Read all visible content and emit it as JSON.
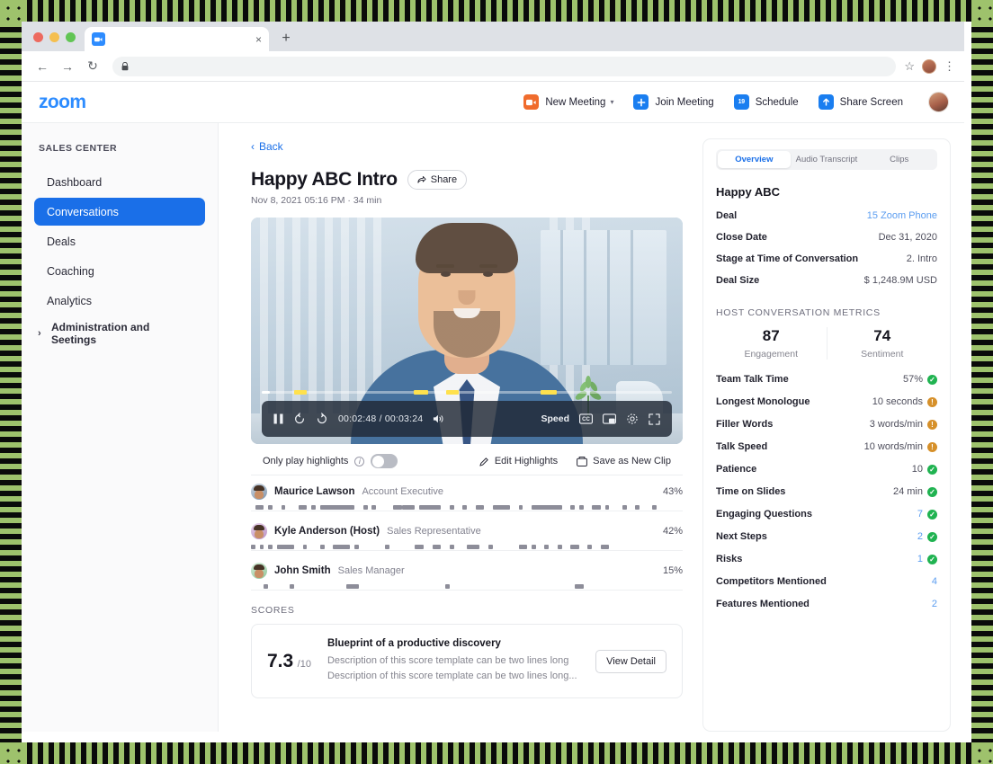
{
  "browser": {
    "tab_title": "",
    "tab_close_glyph": "×",
    "new_tab_glyph": "+",
    "back_glyph": "←",
    "forward_glyph": "→",
    "reload_glyph": "↻",
    "lock_glyph": "🔒",
    "url": "",
    "star_glyph": "☆",
    "menu_glyph": "⋮"
  },
  "app": {
    "logo": "zoom",
    "nav": [
      {
        "label": "New Meeting",
        "icon": "video-camera-icon",
        "has_caret": true,
        "caret": "▾"
      },
      {
        "label": "Join Meeting",
        "icon": "plus-icon",
        "has_caret": false,
        "caret": ""
      },
      {
        "label": "Schedule",
        "icon": "calendar-icon",
        "has_caret": false,
        "caret": ""
      },
      {
        "label": "Share Screen",
        "icon": "upload-arrow-icon",
        "has_caret": false,
        "caret": ""
      }
    ],
    "calendar_day": "19"
  },
  "sidebar": {
    "heading": "SALES CENTER",
    "items": [
      {
        "label": "Dashboard",
        "active": false
      },
      {
        "label": "Conversations",
        "active": true
      },
      {
        "label": "Deals",
        "active": false
      },
      {
        "label": "Coaching",
        "active": false
      },
      {
        "label": "Analytics",
        "active": false
      }
    ],
    "admin": {
      "label": "Administration and Seetings",
      "chevron": "›"
    }
  },
  "content": {
    "back_label": "Back",
    "back_chevron": "‹",
    "title": "Happy ABC Intro",
    "share_label": "Share",
    "subtitle": "Nov 8, 2021 05:16 PM · 34 min",
    "player": {
      "pause_glyph": "▐▐",
      "rewind_label": "10",
      "forward_label": "10",
      "time": "00:02:48 / 00:03:24",
      "speed_label": "Speed",
      "cc_label": "CC",
      "progress_percent": 2,
      "highlight_markers": [
        8,
        37,
        45,
        68
      ]
    },
    "highlights_bar": {
      "toggle_label": "Only play highlights",
      "toggle_on": false,
      "edit_label": "Edit Highlights",
      "save_clip_label": "Save as New Clip"
    },
    "speakers": [
      {
        "name": "Maurice Lawson",
        "role": "Account Executive",
        "percent": "43%",
        "segments": [
          [
            1,
            2
          ],
          [
            4,
            1
          ],
          [
            7,
            1
          ],
          [
            11,
            2
          ],
          [
            14,
            1
          ],
          [
            16,
            8
          ],
          [
            26,
            1
          ],
          [
            28,
            1
          ],
          [
            33,
            2
          ],
          [
            35,
            3
          ],
          [
            39,
            5
          ],
          [
            46,
            1
          ],
          [
            49,
            1
          ],
          [
            52,
            2
          ],
          [
            56,
            4
          ],
          [
            62,
            1
          ],
          [
            65,
            7
          ],
          [
            74,
            1
          ],
          [
            76,
            1
          ],
          [
            79,
            2
          ],
          [
            82,
            1
          ],
          [
            86,
            1
          ],
          [
            89,
            1
          ],
          [
            93,
            1
          ]
        ]
      },
      {
        "name": "Kyle Anderson (Host)",
        "role": "Sales Representative",
        "percent": "42%",
        "segments": [
          [
            0,
            1
          ],
          [
            2,
            1
          ],
          [
            4,
            1
          ],
          [
            6,
            4
          ],
          [
            12,
            1
          ],
          [
            16,
            1
          ],
          [
            19,
            4
          ],
          [
            24,
            1
          ],
          [
            31,
            1
          ],
          [
            38,
            2
          ],
          [
            42,
            2
          ],
          [
            46,
            1
          ],
          [
            50,
            3
          ],
          [
            55,
            1
          ],
          [
            62,
            2
          ],
          [
            65,
            1
          ],
          [
            68,
            1
          ],
          [
            71,
            1
          ],
          [
            74,
            2
          ],
          [
            78,
            1
          ],
          [
            81,
            2
          ]
        ]
      },
      {
        "name": "John Smith",
        "role": "Sales Manager",
        "percent": "15%",
        "segments": [
          [
            3,
            1
          ],
          [
            9,
            1
          ],
          [
            22,
            3
          ],
          [
            45,
            1
          ],
          [
            75,
            2
          ]
        ]
      }
    ],
    "scores_heading": "SCORES",
    "score": {
      "value": "7.3",
      "denominator": "/10",
      "title": "Blueprint of a productive discovery",
      "desc_line1": "Description of this score template can be two lines long",
      "desc_line2": "Description of this score template can be two lines long...",
      "detail_label": "View Detail"
    }
  },
  "panel": {
    "tabs": [
      {
        "label": "Overview",
        "active": true
      },
      {
        "label": "Audio Transcript",
        "active": false
      },
      {
        "label": "Clips",
        "active": false
      }
    ],
    "title": "Happy ABC",
    "fields": [
      {
        "key": "Deal",
        "value": "15 Zoom Phone",
        "link": true
      },
      {
        "key": "Close Date",
        "value": "Dec 31, 2020",
        "link": false
      },
      {
        "key": "Stage at Time of Conversation",
        "value": "2. Intro",
        "link": false
      },
      {
        "key": "Deal Size",
        "value": "$ 1,248.9M USD",
        "link": false
      }
    ],
    "metrics_heading": "HOST CONVERSATION METRICS",
    "bignums": [
      {
        "value": "87",
        "label": "Engagement"
      },
      {
        "value": "74",
        "label": "Sentiment"
      }
    ],
    "metrics": [
      {
        "key": "Team Talk Time",
        "value": "57%",
        "badge": "ok",
        "blue": false
      },
      {
        "key": "Longest Monologue",
        "value": "10 seconds",
        "badge": "warn",
        "blue": false
      },
      {
        "key": "Filler Words",
        "value": "3 words/min",
        "badge": "warn",
        "blue": false
      },
      {
        "key": "Talk Speed",
        "value": "10 words/min",
        "badge": "warn",
        "blue": false
      },
      {
        "key": "Patience",
        "value": "10",
        "badge": "ok",
        "blue": false
      },
      {
        "key": "Time on Slides",
        "value": "24 min",
        "badge": "ok",
        "blue": false
      },
      {
        "key": "Engaging Questions",
        "value": "7",
        "badge": "ok",
        "blue": true
      },
      {
        "key": "Next Steps",
        "value": "2",
        "badge": "ok",
        "blue": true
      },
      {
        "key": "Risks",
        "value": "1",
        "badge": "ok",
        "blue": true
      },
      {
        "key": "Competitors Mentioned",
        "value": "4",
        "badge": "none",
        "blue": true
      },
      {
        "key": "Features Mentioned",
        "value": "2",
        "badge": "none",
        "blue": true
      }
    ],
    "badge_ok_glyph": "✓",
    "badge_warn_glyph": "!"
  },
  "theme": {
    "accent_blue": "#1a6fe8",
    "zoom_blue": "#2d8cff",
    "link_blue": "#5b9df0",
    "ok_green": "#20b351",
    "warn_amber": "#d6902a",
    "pattern_green": "#9ec26c"
  }
}
